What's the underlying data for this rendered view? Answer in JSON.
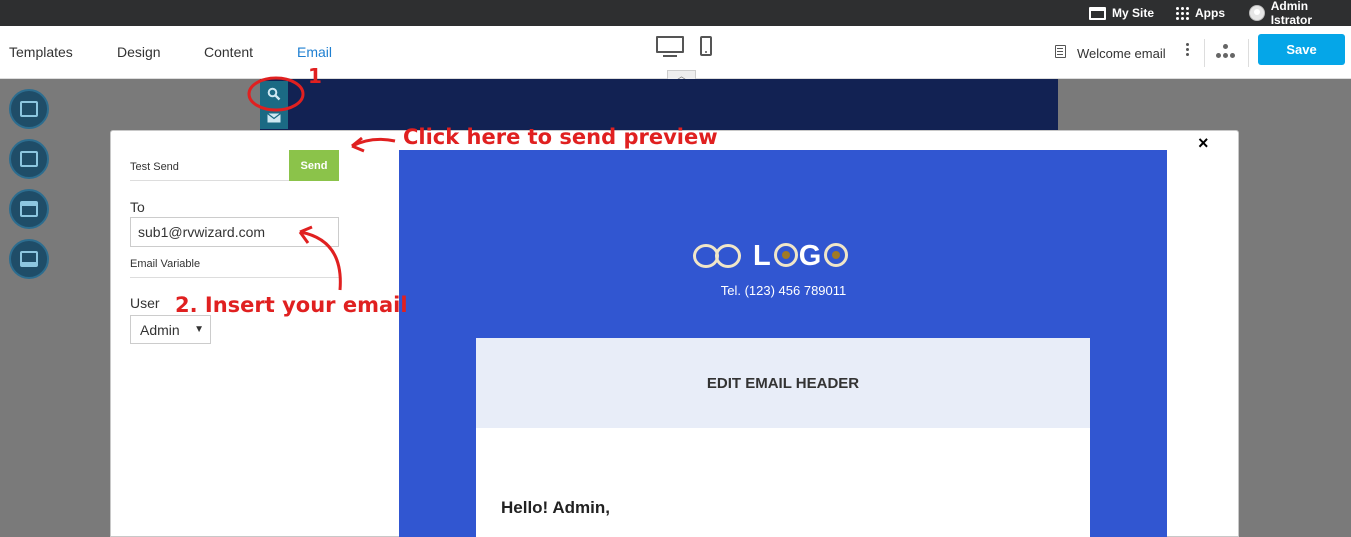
{
  "admin_bar": {
    "my_site": "My Site",
    "apps": "Apps",
    "user": "Admin Istrator"
  },
  "toolbar": {
    "tabs": [
      "Templates",
      "Design",
      "Content",
      "Email"
    ],
    "active_tab": "Email",
    "email_name": "Welcome email",
    "save_label": "Save"
  },
  "modal": {
    "test_send_label": "Test Send",
    "send_label": "Send",
    "to_label": "To",
    "to_value": "sub1@rvwizard.com",
    "email_variable_label": "Email Variable",
    "user_label": "User",
    "user_selected": "Admin",
    "close": "×"
  },
  "preview": {
    "logo_text_pre": "L",
    "logo_text_post": "G",
    "tel": "Tel. (123) 456 789011",
    "header": "EDIT EMAIL HEADER",
    "greeting": "Hello! Admin,"
  },
  "annotations": {
    "step1": "1",
    "send_hint": "Click here to send preview",
    "step2": "2. Insert your email"
  },
  "colors": {
    "accent": "#05a6e8",
    "send": "#8bc34a",
    "email_bg": "#3156d1",
    "annotation": "#e02020"
  }
}
